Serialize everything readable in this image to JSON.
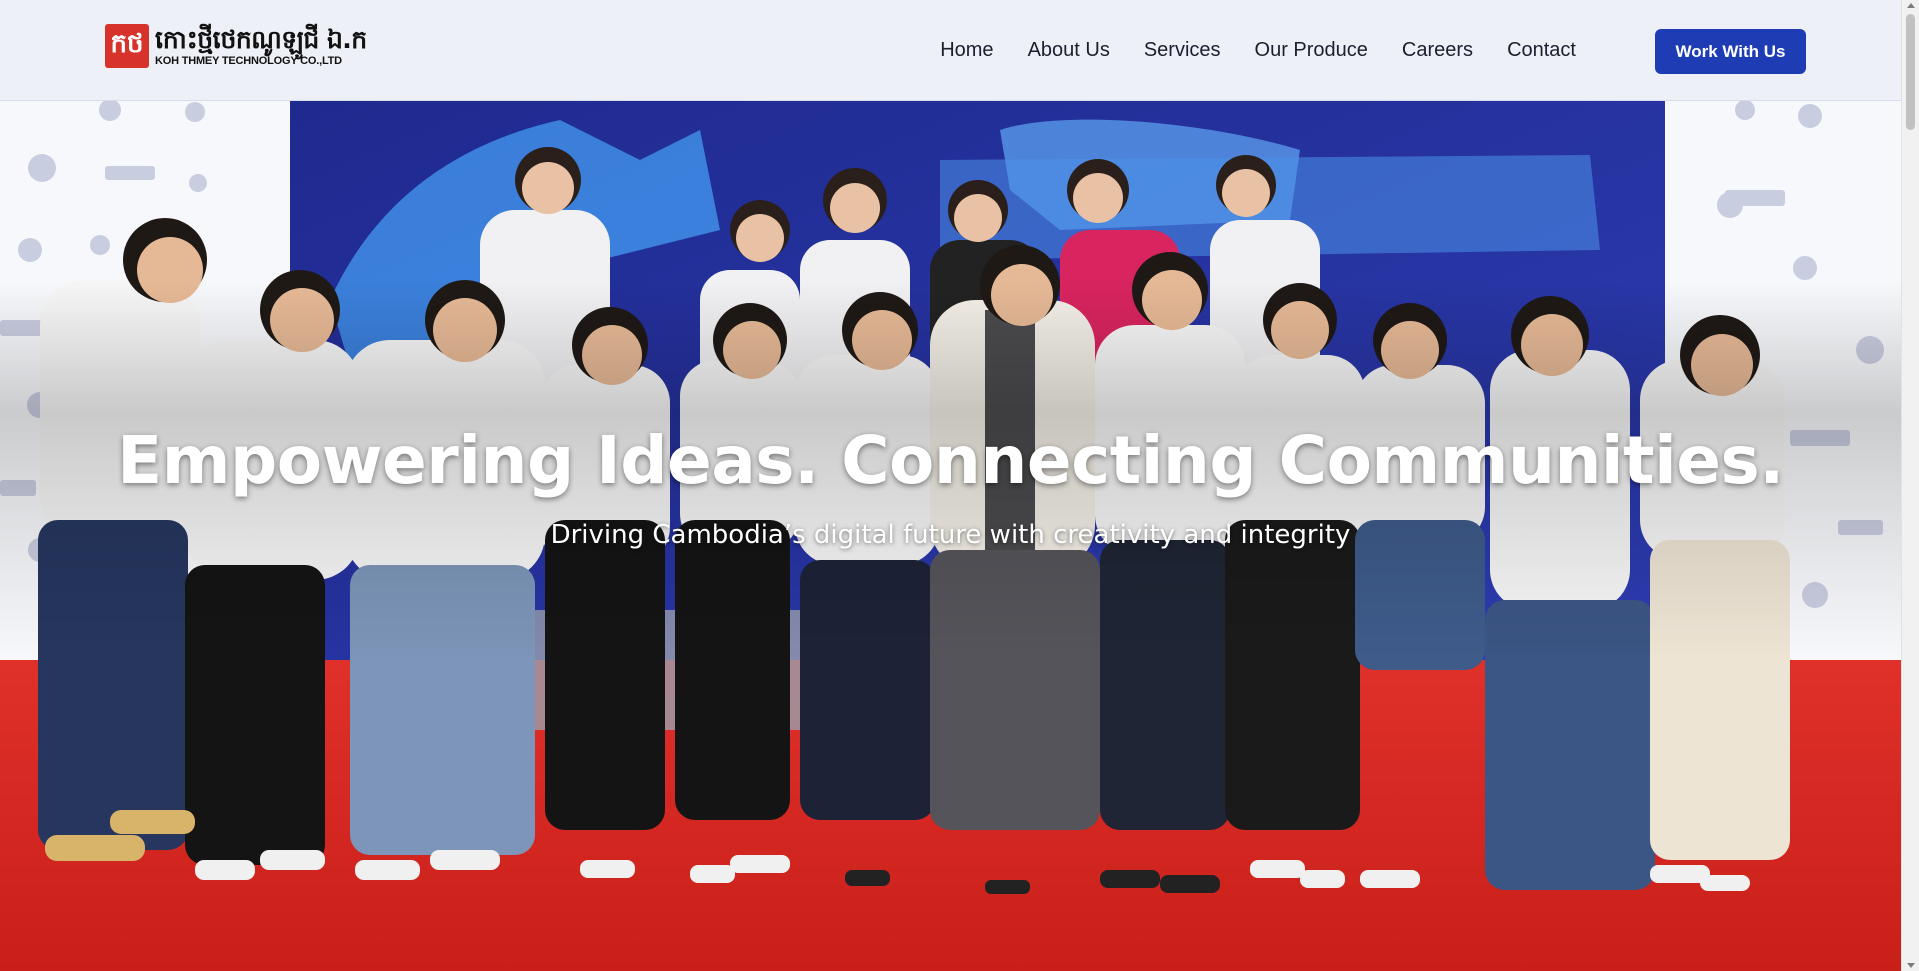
{
  "brand": {
    "logo_mark": "កថ",
    "khmer_name": "កោះថ្មីថេកណូឡូជី ឯ.ក",
    "english_name": "KOH THMEY TECHNOLOGY CO.,LTD"
  },
  "nav": {
    "items": [
      "Home",
      "About Us",
      "Services",
      "Our Produce",
      "Careers",
      "Contact"
    ],
    "cta": "Work With Us"
  },
  "hero": {
    "title": "Empowering Ideas. Connecting Communities.",
    "subtitle": "Driving Cambodia’s digital future with creativity and integrity",
    "image": "group-photo-team-in-white-polo-shirts-on-stage"
  },
  "colors": {
    "cta_blue": "#1e3db5",
    "logo_red": "#d8332b",
    "header_bg": "#eef0f8",
    "stage_red": "#d9271f",
    "backdrop_blue": "#2a2f9c"
  }
}
